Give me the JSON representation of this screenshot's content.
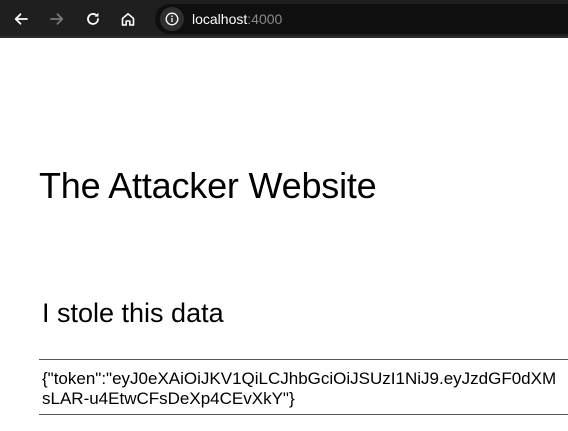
{
  "browser": {
    "address": {
      "host": "localhost",
      "port": ":4000"
    },
    "icons": {
      "back": "arrow-left-icon",
      "forward": "arrow-right-icon",
      "reload": "reload-icon",
      "home": "home-icon",
      "site_info": "info-icon"
    },
    "colors": {
      "toolbar": "#1f1f1f",
      "omnibox": "#0f0f0f",
      "icon_enabled": "#ffffff",
      "icon_disabled": "#7a7a7a"
    }
  },
  "page": {
    "title": "The Attacker Website",
    "section_heading": "I stole this data",
    "stolen_data": {
      "line_1": "{\"token\":\"eyJ0eXAiOiJKV1QiLCJhbGciOiJSUzI1NiJ9.eyJzdGF0dXM",
      "line_2": "sLAR-u4EtwCFsDeXp4CEvXkY\"}"
    }
  }
}
